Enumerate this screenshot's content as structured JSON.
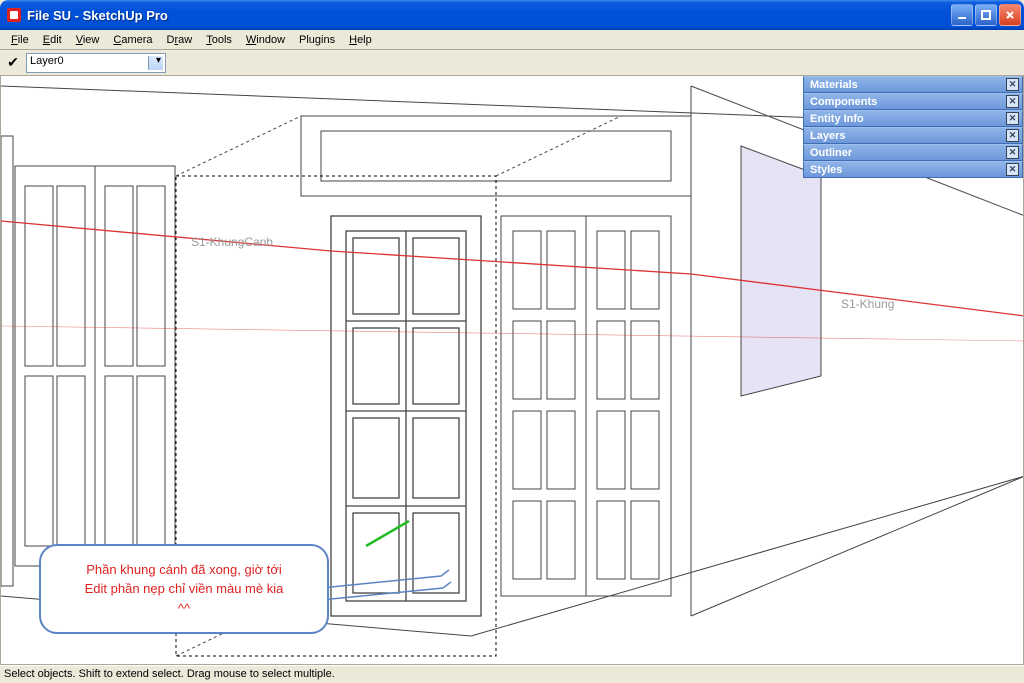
{
  "window": {
    "title": "File SU - SketchUp Pro"
  },
  "menu": {
    "file": "File",
    "edit": "Edit",
    "view": "View",
    "camera": "Camera",
    "draw": "Draw",
    "tools": "Tools",
    "window": "Window",
    "plugins": "Plugins",
    "help": "Help"
  },
  "toolbar": {
    "layer_value": "Layer0"
  },
  "panels": {
    "p1": "Materials",
    "p2": "Components",
    "p3": "Entity Info",
    "p4": "Layers",
    "p5": "Outliner",
    "p6": "Styles"
  },
  "labels": {
    "left_anno": "S1-KhungCanh",
    "right_anno": "S1-Khung"
  },
  "callout": {
    "line1": "Phần khung cánh đã xong, giờ tới",
    "line2": "Edit phần nẹp chỉ viền màu mè kia",
    "line3": "^^"
  },
  "status": {
    "text": "Select objects. Shift to extend select. Drag mouse to select multiple."
  }
}
